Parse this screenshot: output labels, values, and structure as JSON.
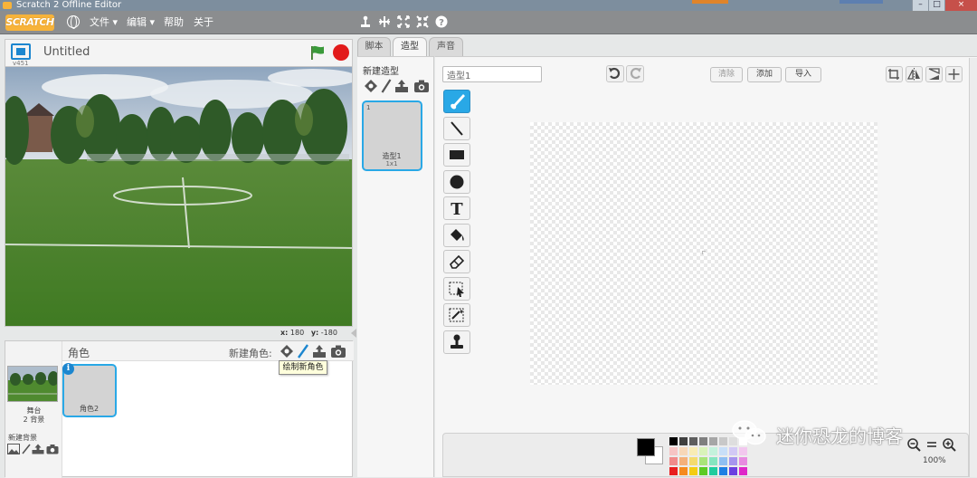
{
  "window": {
    "title": "Scratch 2 Offline Editor",
    "min": "–",
    "max": "□",
    "close": "×"
  },
  "menubar": {
    "logo": "SCRATCH",
    "file": "文件 ▾",
    "edit": "编辑 ▾",
    "help": "帮助",
    "about": "关于"
  },
  "stage": {
    "title": "Untitled",
    "version": "v451",
    "coords_x_label": "x:",
    "coords_x": "180",
    "coords_y_label": "y:",
    "coords_y": "-180"
  },
  "sprites": {
    "header": "角色",
    "new_sprite_label": "新建角色:",
    "tooltip": "绘制新角色",
    "stage_thumb_label": "舞台",
    "stage_thumb_sub": "2 背景",
    "new_backdrop_label": "新建背景",
    "sprite1_name": "角色2",
    "info_badge": "i"
  },
  "tabs": {
    "scripts": "脚本",
    "costumes": "造型",
    "sounds": "声音"
  },
  "costumes": {
    "new_label": "新建造型",
    "item_index": "1",
    "item_name": "造型1",
    "item_size": "1x1"
  },
  "editor": {
    "name_value": "造型1",
    "clear": "清除",
    "add": "添加",
    "import": "导入",
    "zoom": "100%"
  },
  "watermark": "迷你恐龙的博客",
  "colors": {
    "accent": "#29a8e6",
    "stop": "#e21b1b",
    "flag": "#3a9a3a",
    "menubar": "#8b8d8f",
    "logo": "#f7b33a"
  },
  "palette": [
    [
      "#000000",
      "#3f3f3f",
      "#5e5e5e",
      "#7f7f7f",
      "#a6a6a6",
      "#c8c8c8",
      "#dedede",
      "#ffffff"
    ],
    [
      "#f6c4c4",
      "#f7d7b8",
      "#f8ecb5",
      "#d9f3b9",
      "#c4f2dc",
      "#c8dff8",
      "#d2c9f5",
      "#f2c7ee"
    ],
    [
      "#f08a8a",
      "#f4b07a",
      "#f4db6e",
      "#a9e479",
      "#86e5c0",
      "#8fbff2",
      "#a694ee",
      "#e78be0"
    ],
    [
      "#e81f1f",
      "#f58a1e",
      "#f4cc12",
      "#5ccb24",
      "#1fcc9e",
      "#1e7fe3",
      "#6b3fe0",
      "#de27c8"
    ]
  ]
}
